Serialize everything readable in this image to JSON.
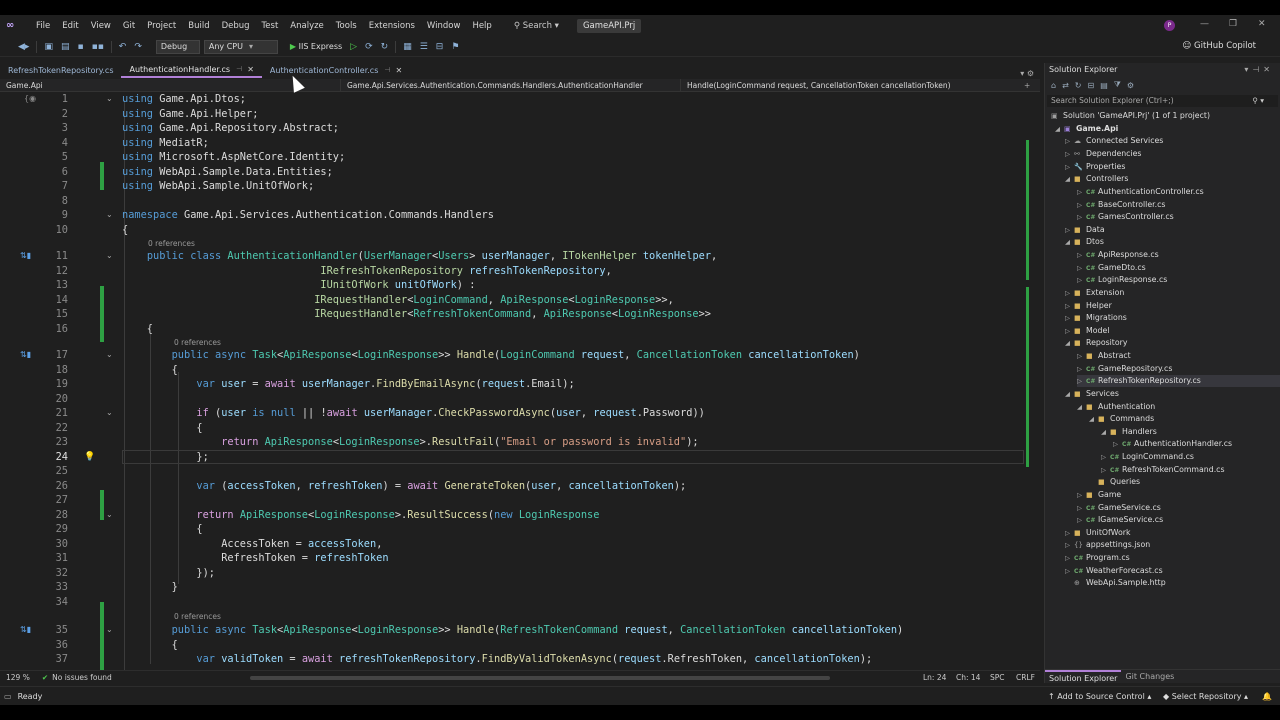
{
  "menubar": {
    "items": [
      "File",
      "Edit",
      "View",
      "Git",
      "Project",
      "Build",
      "Debug",
      "Test",
      "Analyze",
      "Tools",
      "Extensions",
      "Window",
      "Help"
    ],
    "search": "Search",
    "project": "GameAPI.Prj",
    "avatar": "P"
  },
  "toolbar": {
    "config": "Debug",
    "platform": "Any CPU",
    "run": "IIS Express",
    "copilot": "GitHub Copilot"
  },
  "tabs": [
    {
      "label": "RefreshTokenRepository.cs",
      "active": false
    },
    {
      "label": "AuthenticationHandler.cs",
      "active": true
    },
    {
      "label": "AuthenticationController.cs",
      "active": false
    }
  ],
  "navbar": {
    "project": "Game.Api",
    "type": "Game.Api.Services.Authentication.Commands.Handlers.AuthenticationHandler",
    "member": "Handle(LoginCommand request, CancellationToken cancellationToken)"
  },
  "code_refs": {
    "r11": "0 references",
    "r17": "0 references",
    "r35": "0 references"
  },
  "editor_status": {
    "zoom": "129 %",
    "issues": "No issues found",
    "ln": "Ln: 24",
    "ch": "Ch: 14",
    "enc": "SPC",
    "eol": "CRLF"
  },
  "solution_explorer": {
    "title": "Solution Explorer",
    "search_placeholder": "Search Solution Explorer (Ctrl+;)",
    "tree": [
      "Solution 'GameAPI.Prj' (1 of 1 project)",
      "Game.Api",
      "Connected Services",
      "Dependencies",
      "Properties",
      "Controllers",
      "AuthenticationController.cs",
      "BaseController.cs",
      "GamesController.cs",
      "Data",
      "Dtos",
      "ApiResponse.cs",
      "GameDto.cs",
      "LoginResponse.cs",
      "Extension",
      "Helper",
      "Migrations",
      "Model",
      "Repository",
      "Abstract",
      "GameRepository.cs",
      "RefreshTokenRepository.cs",
      "Services",
      "Authentication",
      "Commands",
      "Handlers",
      "AuthenticationHandler.cs",
      "LoginCommand.cs",
      "RefreshTokenCommand.cs",
      "Queries",
      "Game",
      "GameService.cs",
      "IGameService.cs",
      "UnitOfWork",
      "appsettings.json",
      "Program.cs",
      "WeatherForecast.cs",
      "WebApi.Sample.http"
    ],
    "footer_tabs": [
      "Solution Explorer",
      "Git Changes"
    ]
  },
  "statusbar": {
    "ready": "Ready",
    "add_source": "Add to Source Control",
    "select_repo": "Select Repository"
  },
  "colors": {
    "keyword": "#569cd6",
    "type": "#4ec9b0",
    "method": "#dcdcaa",
    "string": "#d69d85",
    "accent": "#b180d7",
    "change": "#2ea043"
  }
}
